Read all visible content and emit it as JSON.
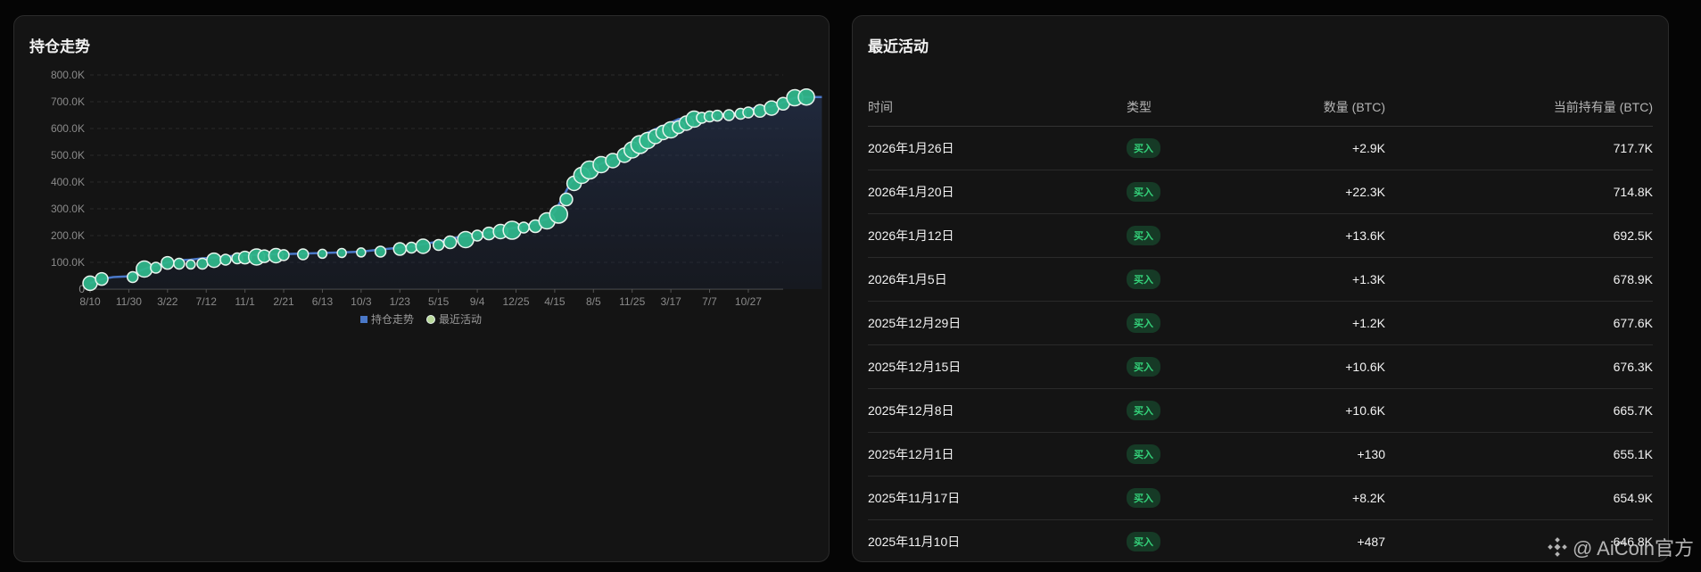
{
  "chart_panel": {
    "title": "持仓走势"
  },
  "chart_data": {
    "type": "line",
    "title": "持仓走势",
    "xlabel": "",
    "ylabel": "",
    "x_ticks": [
      "8/10",
      "11/30",
      "3/22",
      "7/12",
      "11/1",
      "2/21",
      "6/13",
      "10/3",
      "1/23",
      "5/15",
      "9/4",
      "12/25",
      "4/15",
      "8/5",
      "11/25",
      "3/17",
      "7/7",
      "10/27"
    ],
    "y_ticks": [
      "0",
      "100.0K",
      "200.0K",
      "300.0K",
      "400.0K",
      "500.0K",
      "600.0K",
      "700.0K",
      "800.0K"
    ],
    "ylim": [
      0,
      800000
    ],
    "grid": true,
    "legend_position": "bottom",
    "series": [
      {
        "name": "持仓走势",
        "type": "area-line",
        "color": "#4a78c8",
        "x": [
          0,
          0.3,
          0.6,
          1,
          1.3,
          1.6,
          1.9,
          2.0,
          2.3,
          2.6,
          2.9,
          3.2,
          3.6,
          3.8,
          4.0,
          4.3,
          4.6,
          5,
          5.5,
          6,
          6.5,
          7,
          7.5,
          8,
          8.3,
          8.6,
          9,
          9.3,
          9.6,
          10,
          10.3,
          10.6,
          10.9,
          11.2,
          11.5,
          11.8,
          12,
          12.2,
          12.4,
          12.6,
          13,
          13.3,
          13.6,
          13.9,
          14.0,
          14.1,
          14.2,
          14.3,
          14.4,
          14.6,
          14.8,
          15,
          15.2,
          15.4,
          15.6,
          15.8,
          16,
          16.2,
          16.5,
          16.8,
          17,
          17.2,
          17.5,
          17.8,
          18.2,
          18.4,
          18.6,
          18.9
        ],
        "y": [
          22000,
          38000,
          45000,
          48000,
          70000,
          85000,
          95000,
          100000,
          108000,
          110000,
          115000,
          118000,
          123000,
          125000,
          127000,
          128000,
          130000,
          131000,
          133000,
          135000,
          137000,
          140000,
          148000,
          155000,
          160000,
          168000,
          178000,
          188000,
          197000,
          205000,
          212000,
          220000,
          228000,
          236000,
          248000,
          262000,
          290000,
          340000,
          395000,
          430000,
          455000,
          475000,
          495000,
          515000,
          530000,
          545000,
          560000,
          572000,
          585000,
          598000,
          610000,
          622000,
          635000,
          640000,
          645000,
          648000,
          650000,
          652000,
          655000,
          660000,
          670000,
          677600,
          678900,
          692500,
          714800,
          717700,
          717700,
          717700
        ]
      },
      {
        "name": "最近活动",
        "type": "scatter",
        "color": "#2fb58a",
        "x": [
          0,
          0.3,
          1.1,
          1.4,
          1.7,
          2.0,
          2.3,
          2.6,
          2.9,
          3.2,
          3.5,
          3.8,
          4.0,
          4.3,
          4.5,
          4.8,
          5.0,
          5.5,
          6.0,
          6.5,
          7.0,
          7.5,
          8.0,
          8.3,
          8.6,
          9.0,
          9.3,
          9.7,
          10.0,
          10.3,
          10.6,
          10.9,
          11.2,
          11.5,
          11.8,
          12.1,
          12.3,
          12.5,
          12.7,
          12.9,
          13.2,
          13.5,
          13.8,
          14.0,
          14.2,
          14.4,
          14.6,
          14.8,
          15.0,
          15.2,
          15.4,
          15.6,
          15.8,
          16.0,
          16.2,
          16.5,
          16.8,
          17.0,
          17.3,
          17.6,
          17.9,
          18.2,
          18.5
        ],
        "y": [
          22000,
          38000,
          45000,
          75000,
          80000,
          98000,
          95000,
          92000,
          95000,
          108000,
          110000,
          115000,
          118000,
          120000,
          123000,
          125000,
          127000,
          130000,
          132000,
          135000,
          137000,
          140000,
          150000,
          155000,
          160000,
          165000,
          175000,
          185000,
          200000,
          208000,
          215000,
          220000,
          230000,
          235000,
          255000,
          280000,
          335000,
          395000,
          425000,
          445000,
          465000,
          480000,
          500000,
          520000,
          540000,
          555000,
          570000,
          585000,
          595000,
          605000,
          620000,
          635000,
          640000,
          645000,
          648000,
          650000,
          655000,
          660000,
          665700,
          676300,
          692500,
          714800,
          717700
        ],
        "sizes": [
          8,
          7,
          6,
          9,
          6,
          7,
          6,
          5,
          6,
          8,
          6,
          6,
          7,
          9,
          7,
          8,
          6,
          6,
          5,
          5,
          5,
          6,
          7,
          6,
          8,
          6,
          7,
          9,
          6,
          7,
          8,
          10,
          6,
          7,
          9,
          10,
          7,
          8,
          9,
          10,
          9,
          8,
          8,
          9,
          10,
          9,
          8,
          8,
          9,
          7,
          8,
          9,
          6,
          6,
          6,
          6,
          6,
          6,
          7,
          8,
          7,
          9,
          9
        ]
      }
    ]
  },
  "activity_panel": {
    "title": "最近活动",
    "columns": {
      "time": "时间",
      "type": "类型",
      "qty": "数量 (BTC)",
      "holding": "当前持有量 (BTC)"
    },
    "rows": [
      {
        "time": "2026年1月26日",
        "type": "买入",
        "qty": "+2.9K",
        "holding": "717.7K"
      },
      {
        "time": "2026年1月20日",
        "type": "买入",
        "qty": "+22.3K",
        "holding": "714.8K"
      },
      {
        "time": "2026年1月12日",
        "type": "买入",
        "qty": "+13.6K",
        "holding": "692.5K"
      },
      {
        "time": "2026年1月5日",
        "type": "买入",
        "qty": "+1.3K",
        "holding": "678.9K"
      },
      {
        "time": "2025年12月29日",
        "type": "买入",
        "qty": "+1.2K",
        "holding": "677.6K"
      },
      {
        "time": "2025年12月15日",
        "type": "买入",
        "qty": "+10.6K",
        "holding": "676.3K"
      },
      {
        "time": "2025年12月8日",
        "type": "买入",
        "qty": "+10.6K",
        "holding": "665.7K"
      },
      {
        "time": "2025年12月1日",
        "type": "买入",
        "qty": "+130",
        "holding": "655.1K"
      },
      {
        "time": "2025年11月17日",
        "type": "买入",
        "qty": "+8.2K",
        "holding": "654.9K"
      },
      {
        "time": "2025年11月10日",
        "type": "买入",
        "qty": "+487",
        "holding": "646.8K"
      }
    ]
  },
  "watermark": {
    "text": "@ AiCoin官方"
  }
}
